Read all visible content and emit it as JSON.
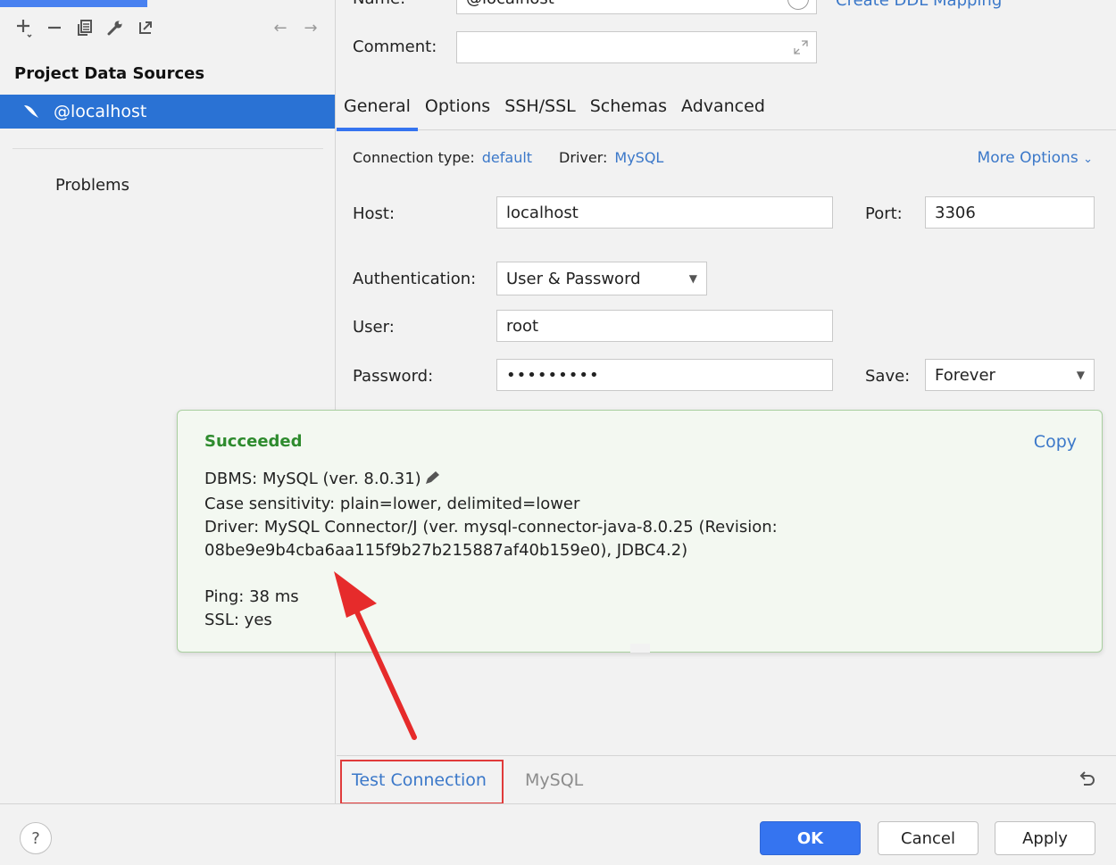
{
  "left_panel": {
    "section_title": "Project Data Sources",
    "selected_source": "@localhost",
    "problems": "Problems",
    "toolbar": {
      "add": "+",
      "remove": "−",
      "back": "←",
      "forward": "→"
    }
  },
  "general": {
    "name_label": "Name:",
    "name_value": "@localhost",
    "ddl_link": "Create DDL Mapping",
    "comment_label": "Comment:",
    "comment_value": ""
  },
  "tabs": [
    "General",
    "Options",
    "SSH/SSL",
    "Schemas",
    "Advanced"
  ],
  "connection": {
    "type_label": "Connection type:",
    "type_value": "default",
    "driver_label": "Driver:",
    "driver_value": "MySQL",
    "more_options": "More Options"
  },
  "fields": {
    "host_label": "Host:",
    "host_value": "localhost",
    "port_label": "Port:",
    "port_value": "3306",
    "auth_label": "Authentication:",
    "auth_value": "User & Password",
    "user_label": "User:",
    "user_value": "root",
    "password_label": "Password:",
    "password_value": "•••••••••",
    "save_label": "Save:",
    "save_value": "Forever"
  },
  "popup": {
    "title": "Succeeded",
    "copy": "Copy",
    "dbms": "DBMS: MySQL (ver. 8.0.31)",
    "case": "Case sensitivity: plain=lower, delimited=lower",
    "driver_line1": "Driver: MySQL Connector/J (ver. mysql-connector-java-8.0.25 (Revision:",
    "driver_line2": "08be9e9b4cba6aa115f9b27b215887af40b159e0), JDBC4.2)",
    "ping": "Ping: 38 ms",
    "ssl": "SSL: yes"
  },
  "bottom_bar": {
    "test_connection": "Test Connection",
    "driver": "MySQL"
  },
  "footer": {
    "help": "?",
    "ok": "OK",
    "cancel": "Cancel",
    "apply": "Apply"
  },
  "colors": {
    "accent": "#3574f0",
    "selection": "#2a72d4",
    "link": "#3b78c9",
    "success": "#2e8b2e",
    "highlight_box": "#e03b3b"
  }
}
